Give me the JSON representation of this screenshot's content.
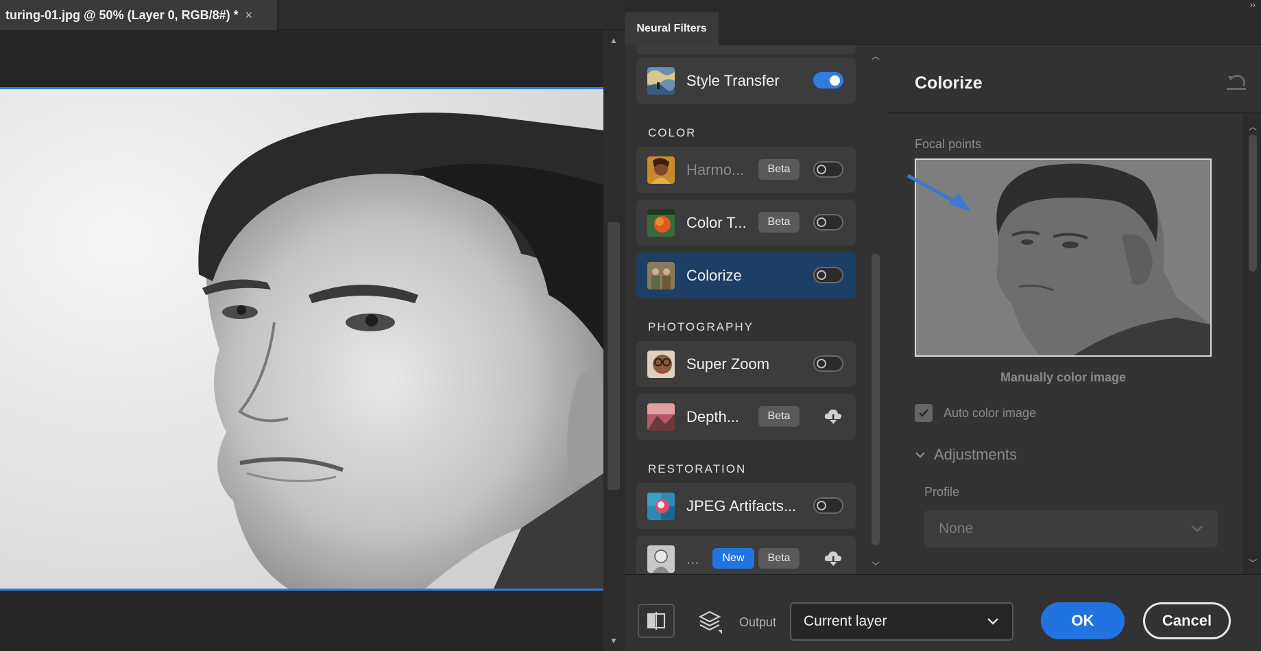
{
  "document": {
    "tab_title": "turing-01.jpg @ 50% (Layer 0, RGB/8#) *",
    "close_glyph": "×"
  },
  "panel": {
    "tab": "Neural Filters",
    "expand_glyph": "››"
  },
  "sections": {
    "color": "COLOR",
    "photography": "PHOTOGRAPHY",
    "restoration": "RESTORATION"
  },
  "filters": [
    {
      "label": "Style Transfer",
      "enabled": true,
      "icon": "style-transfer-thumbnail"
    },
    {
      "label": "Harmo...",
      "badge": "Beta",
      "enabled": false,
      "dimmed": true,
      "icon": "harmonization-thumbnail"
    },
    {
      "label": "Color T...",
      "badge": "Beta",
      "enabled": false,
      "icon": "color-transfer-thumbnail"
    },
    {
      "label": "Colorize",
      "enabled": false,
      "selected": true,
      "icon": "colorize-thumbnail"
    },
    {
      "label": "Super Zoom",
      "enabled": false,
      "icon": "super-zoom-thumbnail"
    },
    {
      "label": "Depth...",
      "badge": "Beta",
      "download": true,
      "icon": "depth-blur-thumbnail"
    },
    {
      "label": "JPEG Artifacts...",
      "enabled": false,
      "icon": "jpeg-artifacts-thumbnail"
    },
    {
      "label": "...",
      "badge_new": "New",
      "badge": "Beta",
      "download": true,
      "icon": "photo-restoration-thumbnail"
    }
  ],
  "detail": {
    "title": "Colorize",
    "focal_points_label": "Focal points",
    "manual_label": "Manually color image",
    "auto_color_label": "Auto color image",
    "auto_color_checked": true,
    "adjustments_label": "Adjustments",
    "profile_label": "Profile",
    "profile_value": "None"
  },
  "footer": {
    "output_label": "Output",
    "output_value": "Current layer",
    "ok_label": "OK",
    "cancel_label": "Cancel"
  },
  "colors": {
    "accent": "#2174e0",
    "selected_row": "#1d3f66",
    "canvas_border": "#2f7de1"
  }
}
